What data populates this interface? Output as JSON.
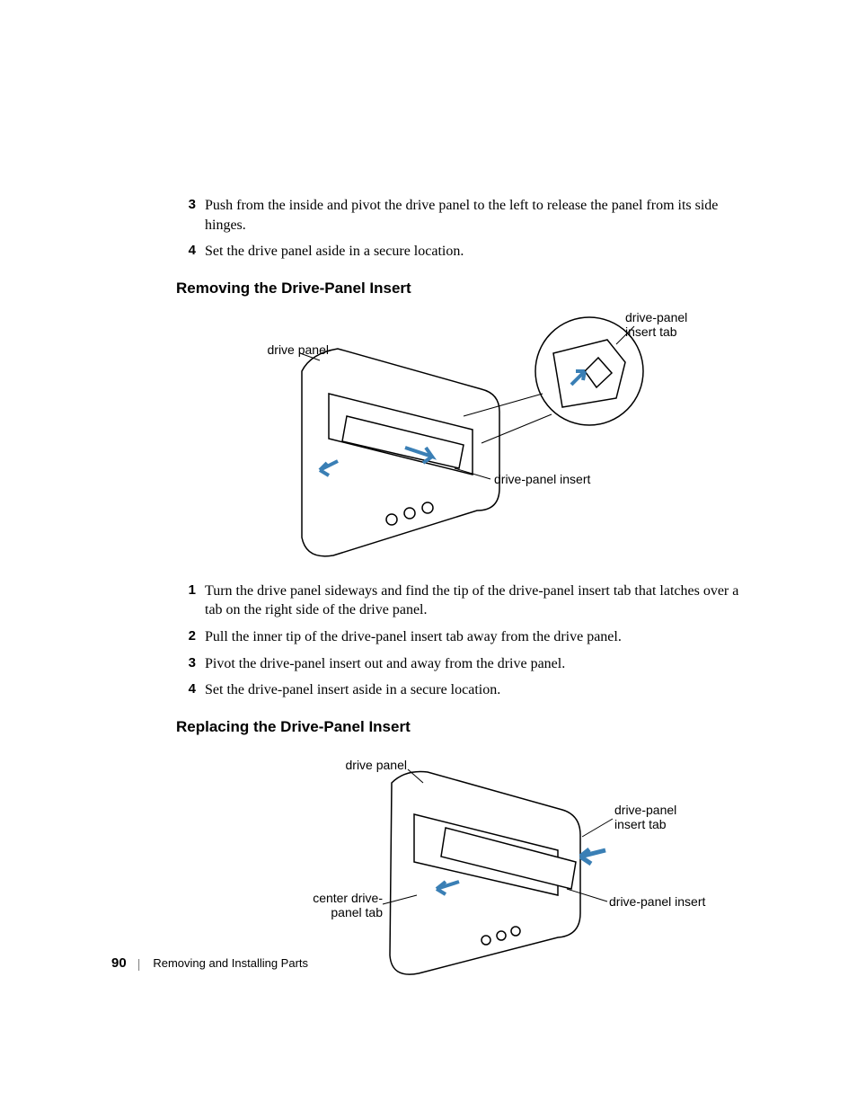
{
  "steps_top": [
    {
      "n": "3",
      "t": "Push from the inside and pivot the drive panel to the left to release the panel from its side hinges."
    },
    {
      "n": "4",
      "t": "Set the drive panel aside in a secure location."
    }
  ],
  "heading1": "Removing the Drive-Panel Insert",
  "fig1": {
    "label_drive_panel": "drive panel",
    "label_insert_tab": "drive-panel insert tab",
    "label_insert": "drive-panel insert"
  },
  "steps_mid": [
    {
      "n": "1",
      "t": "Turn the drive panel sideways and find the tip of the drive-panel insert tab that latches over a tab on the right side of the drive panel."
    },
    {
      "n": "2",
      "t": "Pull the inner tip of the drive-panel insert tab away from the drive panel."
    },
    {
      "n": "3",
      "t": "Pivot the drive-panel insert out and away from the drive panel."
    },
    {
      "n": "4",
      "t": "Set the drive-panel insert aside in a secure location."
    }
  ],
  "heading2": "Replacing the Drive-Panel Insert",
  "fig2": {
    "label_drive_panel": "drive panel",
    "label_insert_tab": "drive-panel insert tab",
    "label_center_tab_l1": "center drive-",
    "label_center_tab_l2": "panel tab",
    "label_insert": "drive-panel insert"
  },
  "footer": {
    "page": "90",
    "title": "Removing and Installing Parts"
  }
}
